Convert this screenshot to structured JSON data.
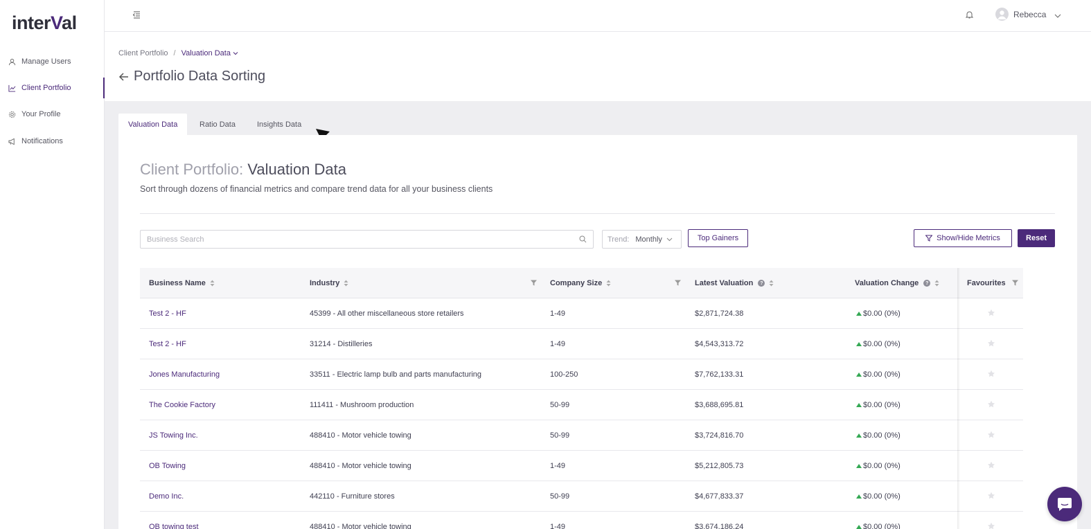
{
  "logo": {
    "text_main": "inter",
    "text_accent": "V",
    "text_end": "al"
  },
  "sidebar": {
    "items": [
      {
        "label": "Manage Users",
        "icon": "user-icon"
      },
      {
        "label": "Client Portfolio",
        "icon": "chart-icon",
        "active": true
      },
      {
        "label": "Your Profile",
        "icon": "gear-icon"
      },
      {
        "label": "Notifications",
        "icon": "megaphone-icon"
      }
    ]
  },
  "topbar": {
    "username": "Rebecca"
  },
  "breadcrumb": {
    "root": "Client Portfolio",
    "separator": "/",
    "current": "Valuation Data"
  },
  "page": {
    "title": "Portfolio Data Sorting"
  },
  "tabs": [
    {
      "label": "Valuation Data",
      "active": true
    },
    {
      "label": "Ratio Data"
    },
    {
      "label": "Insights Data"
    }
  ],
  "section": {
    "title_light": "Client Portfolio:",
    "title_dark": "Valuation Data",
    "subtitle": "Sort through dozens of financial metrics and compare trend data for all your business clients"
  },
  "controls": {
    "search_placeholder": "Business Search",
    "trend_label": "Trend:",
    "trend_value": "Monthly",
    "top_gainers": "Top Gainers",
    "show_hide": "Show/Hide Metrics",
    "reset": "Reset"
  },
  "table": {
    "headers": {
      "business": "Business Name",
      "industry": "Industry",
      "size": "Company Size",
      "valuation": "Latest Valuation",
      "change": "Valuation Change",
      "favourites": "Favourites"
    },
    "help_glyph": "?",
    "rows": [
      {
        "name": "Test 2 - HF",
        "industry": "45399 - All other miscellaneous store retailers",
        "size": "1-49",
        "valuation": "$2,871,724.38",
        "change": "$0.00 (0%)"
      },
      {
        "name": "Test 2 - HF",
        "industry": "31214 - Distilleries",
        "size": "1-49",
        "valuation": "$4,543,313.72",
        "change": "$0.00 (0%)"
      },
      {
        "name": "Jones Manufacturing",
        "industry": "33511 - Electric lamp bulb and parts manufacturing",
        "size": "100-250",
        "valuation": "$7,762,133.31",
        "change": "$0.00 (0%)"
      },
      {
        "name": "The Cookie Factory",
        "industry": "111411 - Mushroom production",
        "size": "50-99",
        "valuation": "$3,688,695.81",
        "change": "$0.00 (0%)"
      },
      {
        "name": "JS Towing Inc.",
        "industry": "488410 - Motor vehicle towing",
        "size": "50-99",
        "valuation": "$3,724,816.70",
        "change": "$0.00 (0%)"
      },
      {
        "name": "OB Towing",
        "industry": "488410 - Motor vehicle towing",
        "size": "1-49",
        "valuation": "$5,212,805.73",
        "change": "$0.00 (0%)"
      },
      {
        "name": "Demo Inc.",
        "industry": "442110 - Furniture stores",
        "size": "50-99",
        "valuation": "$4,677,833.37",
        "change": "$0.00 (0%)"
      },
      {
        "name": "OB towing test",
        "industry": "488410 - Motor vehicle towing",
        "size": "1-49",
        "valuation": "$3,674,186.24",
        "change": "$0.00 (0%)"
      }
    ]
  },
  "colors": {
    "brand": "#4b2a7a",
    "positive": "#34a853",
    "background": "#eeeef1"
  }
}
